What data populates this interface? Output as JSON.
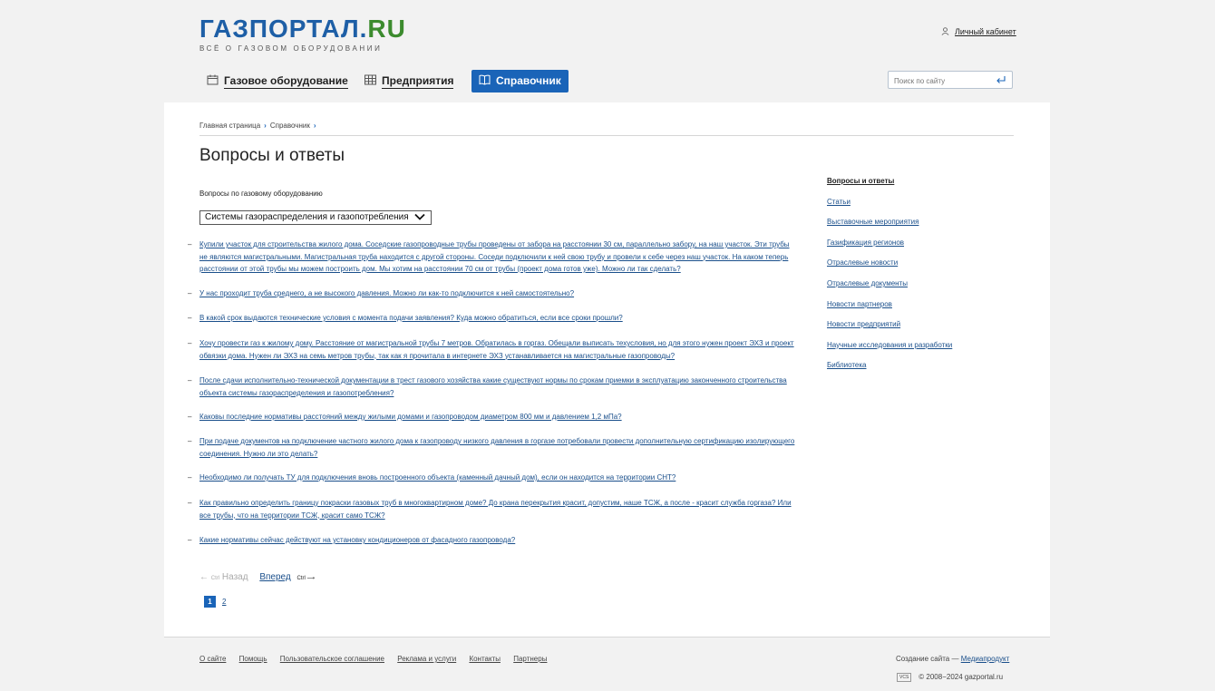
{
  "header": {
    "logo_main": "ГАЗПОРТАЛ.",
    "logo_suffix": "RU",
    "logo_tagline": "ВСЁ О ГАЗОВОМ ОБОРУДОВАНИИ",
    "cabinet_label": "Личный кабинет",
    "search_placeholder": "Поиск по сайту"
  },
  "nav": {
    "items": [
      {
        "label": "Газовое оборудование",
        "icon": "calendar-icon"
      },
      {
        "label": "Предприятия",
        "icon": "grid-icon"
      },
      {
        "label": "Справочник",
        "icon": "book-icon",
        "active": true
      }
    ]
  },
  "breadcrumbs": [
    "Главная страница",
    "Справочник"
  ],
  "page_title": "Вопросы и ответы",
  "filter": {
    "label": "Вопросы по газовому оборудованию",
    "selected": "Системы газораспределения и газопотребления"
  },
  "questions": [
    "Купили участок для строительства жилого дома. Соседские газопроводные трубы проведены от забора на расстоянии 30 см, параллельно забору, на наш участок. Эти трубы не являются магистральными. Магистральная труба находится с другой стороны. Соседи подключили к ней свою трубу и провели к себе через наш участок. На каком теперь расстоянии от этой трубы мы можем построить дом. Мы хотим на расстоянии 70 см от трубы (проект дома готов уже). Можно ли так сделать?",
    "У нас проходит труба среднего, а не высокого давления. Можно ли как-то подключится к ней самостоятельно?",
    "В какой срок выдаются технические условия с момента подачи заявления? Куда можно обратиться, если все сроки прошли?",
    "Хочу провести газ к жилому дому. Расстояние от магистральной трубы 7 метров. Обратилась в горгаз. Обещали выписать техусловия, но для этого нужен проект ЭХЗ и проект обвязки дома. Нужен ли ЭХЗ на семь метров трубы, так как я прочитала в интернете ЭХЗ устанавливается на магистральные газопроводы?",
    "После сдачи исполнительно-технической документации в трест газового хозяйства какие существуют нормы по срокам приемки в эксплуатацию законченного строительства объекта системы газораспределения и газопотребления?",
    "Каковы последние нормативы расстояний между жилыми домами и газопроводом диаметром 800 мм и давлением 1,2 мПа?",
    "При подаче документов на подключение частного жилого дома к газопроводу низкого давления в горгазе потребовали провести дополнительную сертификацию изолирующего соединения. Нужно ли это делать?",
    "Необходимо ли получать ТУ для подключения вновь построенного объекта (каменный дачный дом), если он находится на территории СНТ?",
    "Как правильно определить границу покраски газовых труб в многоквартирном доме? До крана перекрытия красит, допустим, наше ТСЖ, а после - красит служба горгаза? Или все трубы, что на территории ТСЖ, красит само ТСЖ?",
    "Какие нормативы сейчас действуют на установку кондиционеров от фасадного газопровода?"
  ],
  "pager": {
    "prev_label": "Назад",
    "next_label": "Вперед",
    "ctrl": "Ctrl",
    "pages": [
      "1",
      "2"
    ],
    "current": "1"
  },
  "sidebar": [
    "Вопросы и ответы",
    "Статьи",
    "Выставочные мероприятия",
    "Газификация регионов",
    "Отраслевые новости",
    "Отраслевые документы",
    "Новости партнеров",
    "Новости предприятий",
    "Научные исследования и разработки",
    "Библиотека"
  ],
  "footer": {
    "links": [
      "О сайте",
      "Помощь",
      "Пользовательское соглашение",
      "Реклама и услуги",
      "Контакты",
      "Партнеры"
    ],
    "made_label": "Создание сайта —",
    "made_link": "Медиапродукт",
    "copyright": "© 2008−2024 gazportal.ru",
    "vcs": "VCS"
  },
  "colors": {
    "brand_blue": "#1e5fa6",
    "brand_green": "#3c8b2e",
    "active_nav": "#1a64b8",
    "link": "#1a4f8b"
  }
}
